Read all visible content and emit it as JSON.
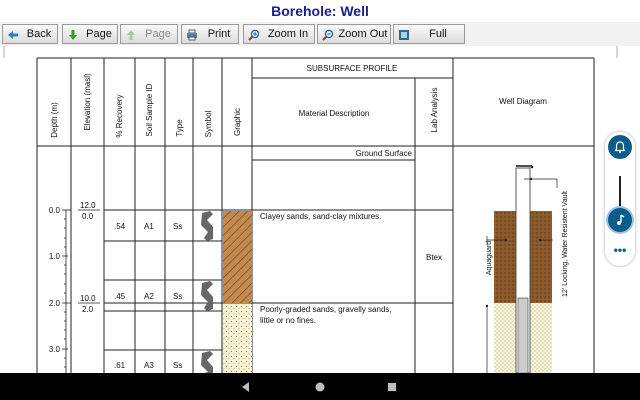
{
  "window": {
    "title": "Borehole: Well"
  },
  "toolbar": {
    "back": "Back",
    "page_next": "Page",
    "page_prev": "Page",
    "print": "Print",
    "zoom_in": "Zoom In",
    "zoom_out": "Zoom Out",
    "full_screen": "Full Screen"
  },
  "log": {
    "headers": {
      "depth": "Depth (m)",
      "elevation": "Elevation (masl)",
      "recovery": "% Recovery",
      "sample_id": "Soil Sample ID",
      "type": "Type",
      "symbol": "Symbol",
      "graphic": "Graphic",
      "subsurface_profile": "SUBSURFACE PROFILE",
      "material_description": "Material Description",
      "lab_analysis": "Lab Analysis",
      "well_diagram": "Well Diagram"
    },
    "depth_ticks": [
      "0.0",
      "1.0",
      "2.0",
      "3.0"
    ],
    "elevations": [
      {
        "elev": "12.0",
        "depth": "0.0"
      },
      {
        "elev": "10.0",
        "depth": "2.0"
      }
    ],
    "ground_surface": "Ground Surface",
    "samples": [
      {
        "recovery": ".54",
        "id": "A1",
        "type": "Ss"
      },
      {
        "recovery": ".45",
        "id": "A2",
        "type": "Ss"
      },
      {
        "recovery": ".61",
        "id": "A3",
        "type": "Ss"
      }
    ],
    "materials": [
      {
        "line1": "Clayey sands, sand-clay mixtures.",
        "line2": ""
      },
      {
        "line1": "Poorly-graded sands, gravelly sands,",
        "line2": "little or no fines."
      }
    ],
    "lab_analysis_value": "Btex",
    "well_labels": {
      "aquaguard": "Aquaguard",
      "vault": "12' Locking, Water Resistent Vault"
    }
  },
  "floating_panel": {
    "more": "•••"
  }
}
